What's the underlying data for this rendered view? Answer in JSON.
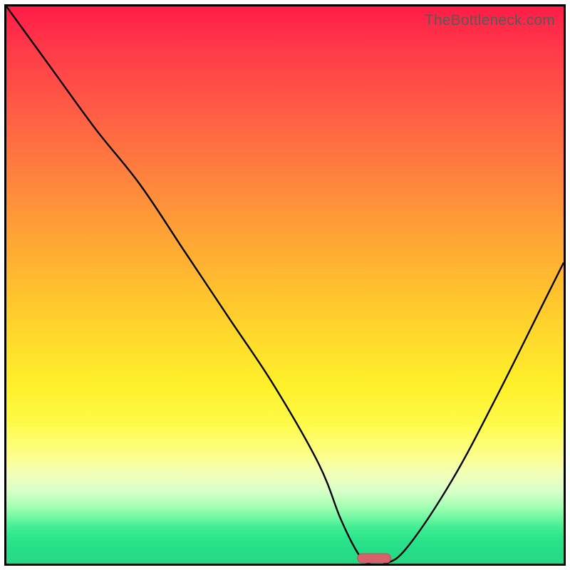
{
  "watermark": "TheBottleneck.com",
  "colors": {
    "frame": "#000000",
    "curve": "#000000",
    "marker_fill": "#d6636b",
    "marker_stroke": "#c24f59",
    "gradient": [
      "#ff1c47",
      "#ff3b49",
      "#ff5a45",
      "#ff7a3f",
      "#ff9a38",
      "#ffb830",
      "#ffd62c",
      "#fff02a",
      "#fffb49",
      "#fcff8a",
      "#f1ffba",
      "#d8ffc8",
      "#9effb2",
      "#42ee93",
      "#28e28a",
      "#25d885"
    ]
  },
  "chart_data": {
    "type": "line",
    "title": "",
    "xlabel": "",
    "ylabel": "",
    "xlim": [
      0,
      100
    ],
    "ylim": [
      0,
      100
    ],
    "x": [
      0,
      8,
      16,
      24,
      32,
      40,
      48,
      56,
      60,
      63,
      65,
      68,
      72,
      80,
      88,
      96,
      100
    ],
    "values": [
      100,
      89,
      78,
      68,
      56,
      44,
      32,
      18,
      8,
      2,
      0,
      0,
      3,
      15,
      30,
      46,
      54
    ],
    "marker": {
      "x_range": [
        63,
        69
      ],
      "y": 0
    },
    "annotations": []
  }
}
